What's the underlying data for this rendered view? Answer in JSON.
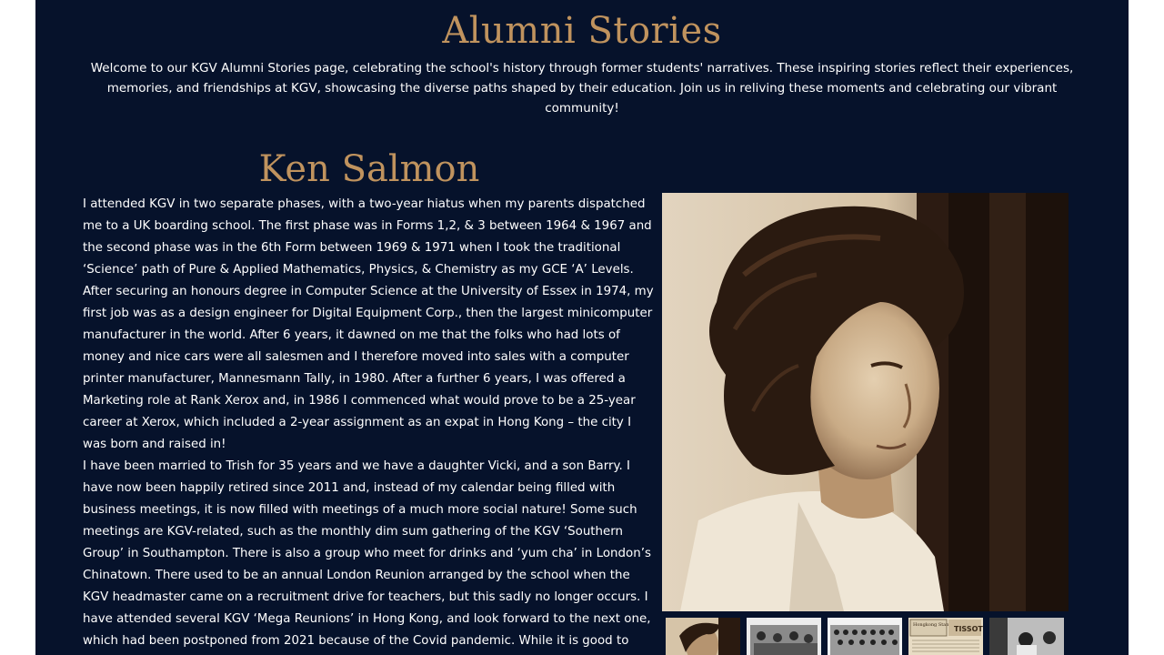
{
  "header": {
    "title": "Alumni Stories",
    "intro": "Welcome to our KGV Alumni Stories page, celebrating the school's history through former students' narratives. These inspiring stories reflect their experiences, memories, and friendships at KGV, showcasing the diverse paths shaped by their education. Join us in reliving these moments and celebrating our vibrant community!"
  },
  "story": {
    "name": "Ken Salmon",
    "paragraphs": [
      "I attended KGV in two separate phases, with a two-year hiatus when my parents dispatched me to a UK boarding school. The first phase was in Forms 1,2, & 3 between 1964 & 1967 and the second phase was in the 6th Form between 1969 & 1971 when I took the traditional ‘Science’ path of Pure & Applied Mathematics, Physics, & Chemistry as my GCE ‘A’ Levels.",
      "After securing an honours degree in Computer Science at the University of Essex in 1974, my first job was as a design engineer for Digital Equipment Corp., then the largest minicomputer manufacturer in the world. After 6 years, it dawned on me that the folks who had lots of money and nice cars were all salesmen and I therefore moved into sales with a computer printer manufacturer, Mannesmann Tally, in 1980. After a further 6 years, I was offered a Marketing role at Rank Xerox and, in 1986 I commenced what would prove to be a 25-year career at Xerox, which included a 2-year assignment as an expat in Hong Kong – the city I was born and raised in!",
      "I have been married to Trish for 35 years and we have a daughter Vicki, and a son Barry. I have now been happily retired since 2011 and, instead of my calendar being filled with business meetings, it is now filled with meetings of a much more social nature! Some such meetings are KGV-related, such as the monthly dim sum gathering of the KGV ‘Southern Group’ in Southampton. There is also a group who meet for drinks and ‘yum cha’ in London’s Chinatown. There used to be an annual London Reunion arranged by the school when the KGV headmaster came on a recruitment drive for teachers, but this sadly no longer occurs. I have attended several KGV ‘Mega Reunions’ in Hong Kong, and look forward to the next one, which had been postponed from 2021 because of the Covid pandemic. While it is good to meet"
    ]
  },
  "gallery": {
    "next_icon": "chevron-right-icon",
    "thumbnails": [
      "portrait",
      "group-photo",
      "class-photo",
      "newspaper-clipping",
      "classroom-photo"
    ],
    "thumb_text": {
      "clip_left": "Hongkong Standard",
      "clip_right": "TISSOT"
    }
  },
  "colors": {
    "background": "#06122b",
    "accent": "#c0935e",
    "text": "#ffffff"
  }
}
